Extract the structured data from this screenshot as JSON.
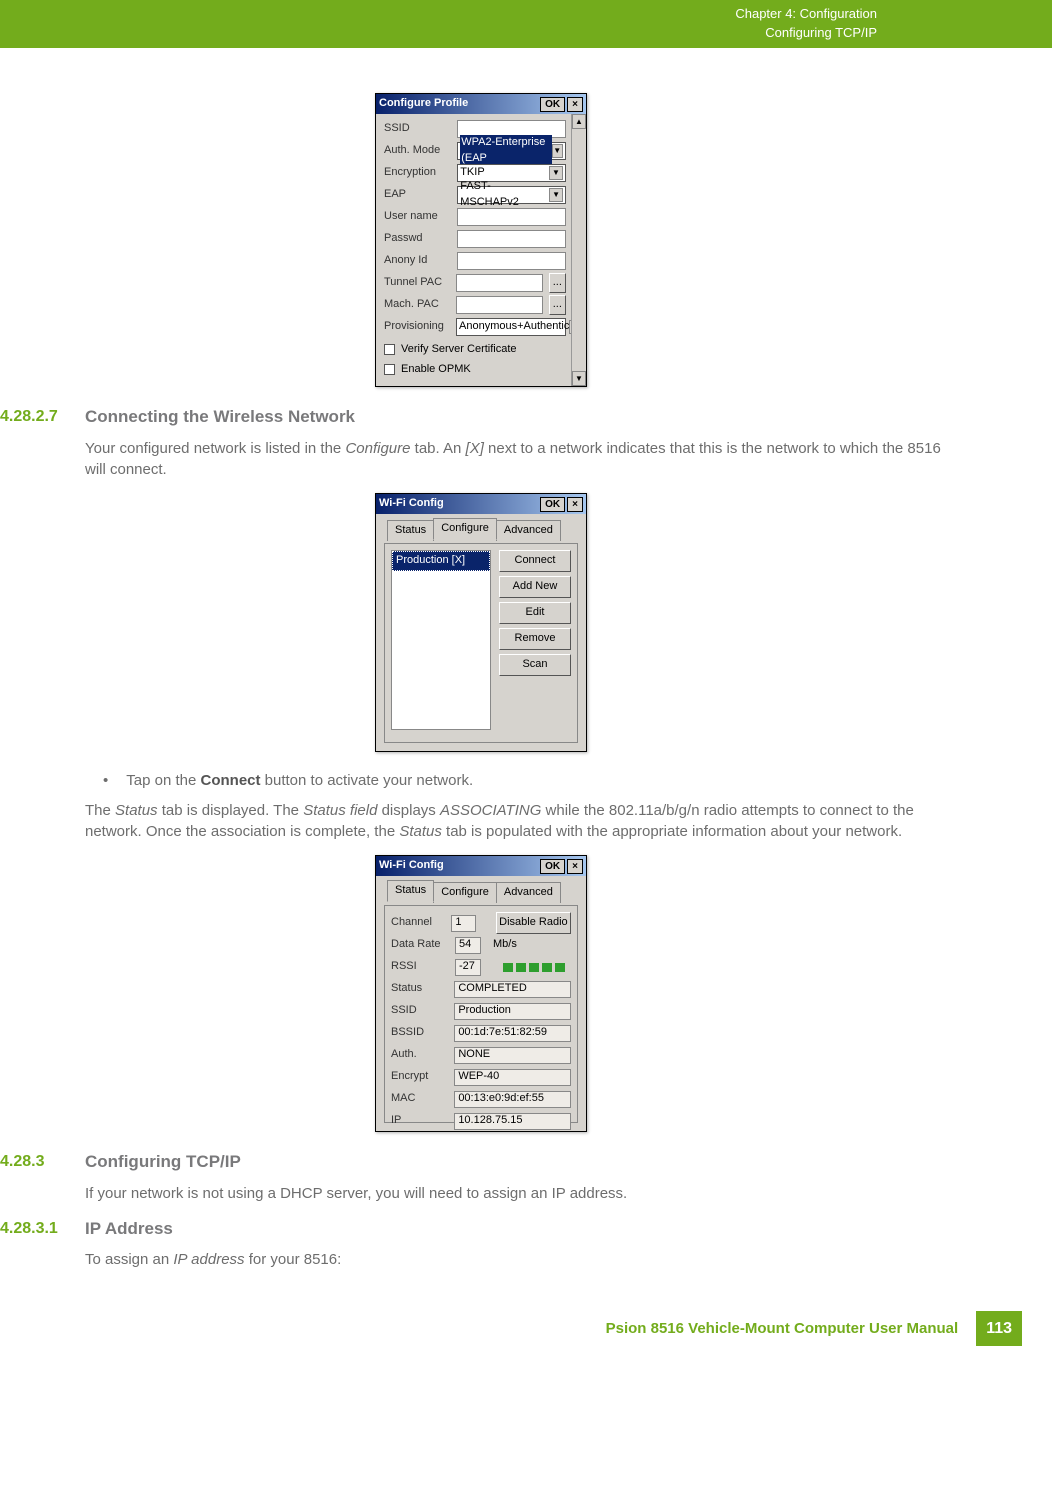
{
  "header": {
    "chapter": "Chapter 4:  Configuration",
    "section": "Configuring TCP/IP"
  },
  "dlg1": {
    "title": "Configure Profile",
    "ok": "OK",
    "x": "×",
    "rows": {
      "ssid_lbl": "SSID",
      "ssid_val": "",
      "auth_lbl": "Auth. Mode",
      "auth_val": "WPA2-Enterprise (EAP",
      "enc_lbl": "Encryption",
      "enc_val": "TKIP",
      "eap_lbl": "EAP",
      "eap_val": "FAST-MSCHAPv2",
      "user_lbl": "User name",
      "user_val": "",
      "pwd_lbl": "Passwd",
      "pwd_val": "",
      "anon_lbl": "Anony Id",
      "anon_val": "",
      "tpac_lbl": "Tunnel PAC",
      "tpac_val": "",
      "tpac_btn": "...",
      "mpac_lbl": "Mach. PAC",
      "mpac_val": "",
      "mpac_btn": "...",
      "prov_lbl": "Provisioning",
      "prov_val": "Anonymous+Authentic"
    },
    "chk1": "Verify Server Certificate",
    "chk2": "Enable OPMK"
  },
  "sec1": {
    "num": "4.28.2.7",
    "title": "Connecting the Wireless Network",
    "p1a": "Your configured network is listed in the ",
    "p1b": "Configure",
    "p1c": " tab. An ",
    "p1d": "[X]",
    "p1e": " next to a network indicates that this is the network to which the 8516 will connect."
  },
  "dlg2": {
    "title": "Wi-Fi Config",
    "ok": "OK",
    "x": "×",
    "tabs": {
      "status": "Status",
      "configure": "Configure",
      "advanced": "Advanced"
    },
    "item": "Production [X]",
    "btns": {
      "connect": "Connect",
      "add": "Add New",
      "edit": "Edit",
      "remove": "Remove",
      "scan": "Scan"
    }
  },
  "bullet": {
    "dot": "•",
    "t1": "Tap on the ",
    "t2": "Connect",
    "t3": " button to activate your network."
  },
  "para2": {
    "a": "The ",
    "b": "Status",
    "c": " tab is displayed. The ",
    "d": "Status field",
    "e": " displays ",
    "f": "ASSOCIATING",
    "g": " while the 802.11a/b/g/n radio attempts to connect to the network. Once the association is complete, the ",
    "h": "Status",
    "i": " tab is populated with the appropriate information about your network."
  },
  "dlg3": {
    "title": "Wi-Fi Config",
    "ok": "OK",
    "x": "×",
    "tabs": {
      "status": "Status",
      "configure": "Configure",
      "advanced": "Advanced"
    },
    "btn": "Disable Radio",
    "rows": {
      "ch_lbl": "Channel",
      "ch_val": "1",
      "dr_lbl": "Data Rate",
      "dr_val": "54",
      "dr_unit": "Mb/s",
      "rssi_lbl": "RSSI",
      "rssi_val": "-27",
      "st_lbl": "Status",
      "st_val": "COMPLETED",
      "ssid_lbl": "SSID",
      "ssid_val": "Production",
      "bssid_lbl": "BSSID",
      "bssid_val": "00:1d:7e:51:82:59",
      "auth_lbl": "Auth.",
      "auth_val": "NONE",
      "enc_lbl": "Encrypt",
      "enc_val": "WEP-40",
      "mac_lbl": "MAC",
      "mac_val": "00:13:e0:9d:ef:55",
      "ip_lbl": "IP",
      "ip_val": "10.128.75.15"
    }
  },
  "sec2": {
    "num": "4.28.3",
    "title": "Configuring TCP/IP",
    "p": "If your network is not using a DHCP server, you will need to assign an IP address."
  },
  "sec3": {
    "num": "4.28.3.1",
    "title": "IP Address",
    "p1": "To assign an ",
    "p2": "IP address",
    "p3": " for your 8516:"
  },
  "footer": {
    "manual": "Psion 8516 Vehicle-Mount Computer User Manual",
    "page": "113"
  }
}
